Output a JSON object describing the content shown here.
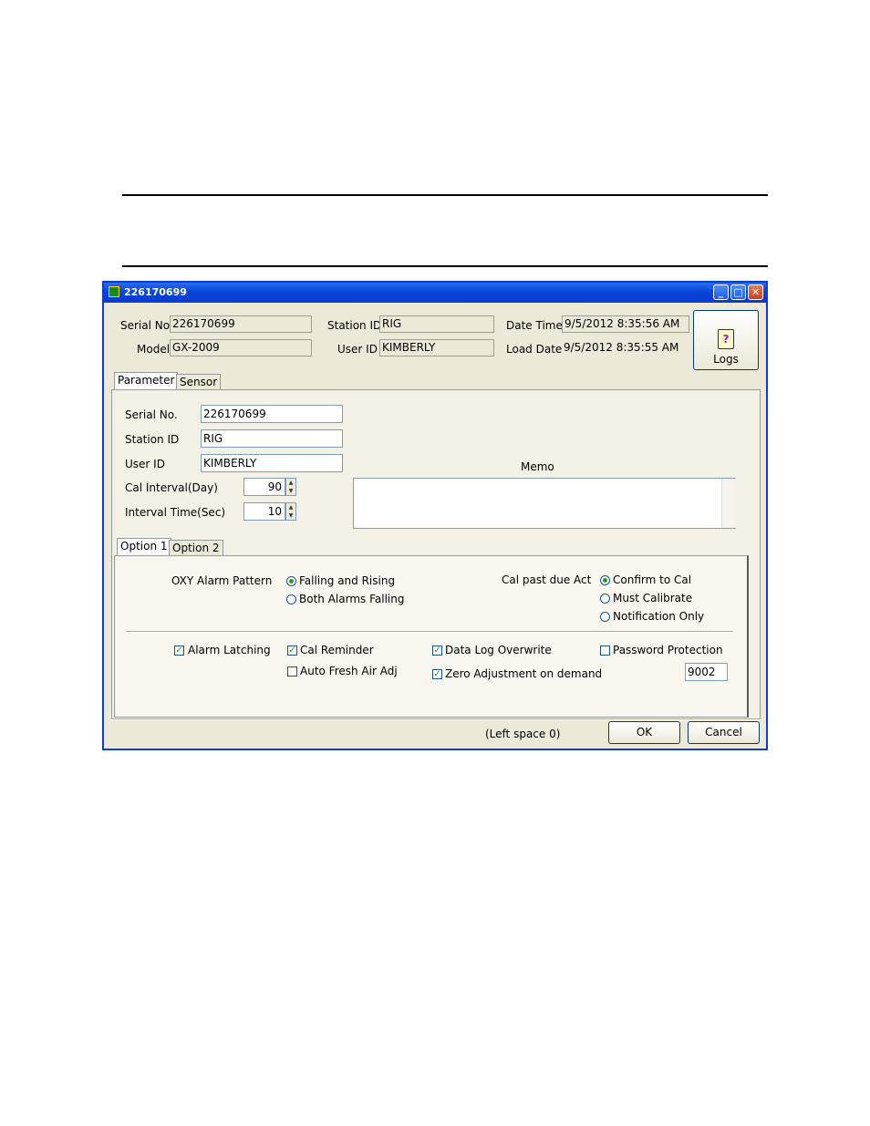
{
  "window": {
    "title": "226170699",
    "min_icon": "minimize-icon",
    "max_icon": "maximize-icon",
    "close_icon": "close-icon"
  },
  "header": {
    "serial_label": "Serial No.",
    "serial_value": "226170699",
    "model_label": "Model",
    "model_value": "GX-2009",
    "station_label": "Station ID",
    "station_value": "RIG",
    "user_label": "User ID",
    "user_value": "KIMBERLY",
    "datetime_label": "Date Time",
    "datetime_value": "9/5/2012 8:35:56 AM",
    "loaddate_label": "Load Date",
    "loaddate_value": "9/5/2012 8:35:55 AM",
    "logs_label": "Logs"
  },
  "tabs": {
    "parameter": "Parameter",
    "sensor": "Sensor"
  },
  "params": {
    "serial_label": "Serial No.",
    "serial_value": "226170699",
    "station_label": "Station ID",
    "station_value": "RIG",
    "user_label": "User ID",
    "user_value": "KIMBERLY",
    "cal_interval_label": "Cal Interval(Day)",
    "cal_interval_value": "90",
    "interval_time_label": "Interval Time(Sec)",
    "interval_time_value": "10",
    "memo_label": "Memo",
    "memo_value": ""
  },
  "subtabs": {
    "option1": "Option 1",
    "option2": "Option 2"
  },
  "option1": {
    "oxy_label": "OXY Alarm Pattern",
    "oxy_options": [
      "Falling and Rising",
      "Both Alarms Falling"
    ],
    "cal_past_label": "Cal past due Act",
    "cal_past_options": [
      "Confirm to Cal",
      "Must Calibrate",
      "Notification Only"
    ],
    "alarm_latching": "Alarm Latching",
    "cal_reminder": "Cal Reminder",
    "auto_fresh": "Auto Fresh Air Adj",
    "data_log_overwrite": "Data Log Overwrite",
    "zero_adjust": "Zero Adjustment on demand",
    "password_protection": "Password Protection",
    "password_value": "9002"
  },
  "footer": {
    "left_space": "(Left space 0)",
    "ok": "OK",
    "cancel": "Cancel"
  }
}
